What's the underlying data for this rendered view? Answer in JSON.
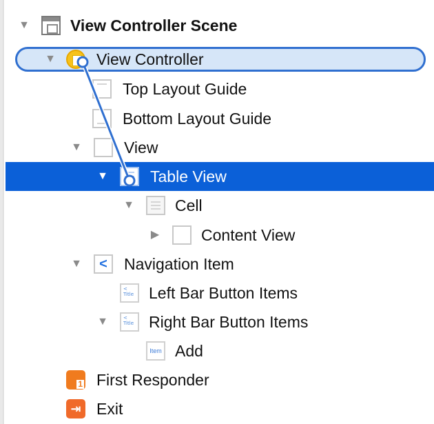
{
  "tree": {
    "scene": {
      "label": "View Controller Scene"
    },
    "view_controller": {
      "label": "View Controller"
    },
    "top_layout_guide": {
      "label": "Top Layout Guide"
    },
    "bottom_layout_guide": {
      "label": "Bottom Layout Guide"
    },
    "view": {
      "label": "View"
    },
    "table_view": {
      "label": "Table View"
    },
    "cell": {
      "label": "Cell"
    },
    "content_view": {
      "label": "Content View"
    },
    "navigation_item": {
      "label": "Navigation Item",
      "icon_glyph": "<"
    },
    "left_bar_button_items": {
      "label": "Left Bar Button Items"
    },
    "right_bar_button_items": {
      "label": "Right Bar Button Items"
    },
    "add_item": {
      "label": "Add",
      "icon_text": "Item"
    },
    "first_responder": {
      "label": "First Responder",
      "icon_text": "1"
    },
    "exit": {
      "label": "Exit"
    }
  },
  "icons": {
    "disclosure_expanded": "▼",
    "disclosure_collapsed": "▶",
    "bar_button_mini": "< Title"
  },
  "colors": {
    "selection": "#0b60d8",
    "connection_outline": "#2f6fd0",
    "connection_fill": "#d6e6f8"
  }
}
